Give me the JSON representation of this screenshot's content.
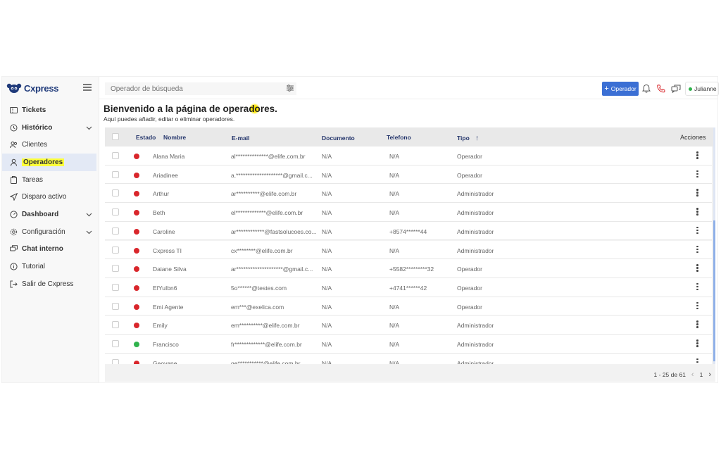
{
  "brand": {
    "name": "Cxpress"
  },
  "sidebar": {
    "items": [
      {
        "label": "Tickets",
        "icon": "ticket-icon",
        "chevron": false,
        "bold": true
      },
      {
        "label": "Histórico",
        "icon": "history-icon",
        "chevron": true,
        "bold": true
      },
      {
        "label": "Clientes",
        "icon": "users-icon",
        "chevron": false,
        "bold": false
      },
      {
        "label": "Operadores",
        "icon": "user-icon",
        "chevron": false,
        "bold": true,
        "active": true
      },
      {
        "label": "Tareas",
        "icon": "clipboard-icon",
        "chevron": false,
        "bold": false
      },
      {
        "label": "Disparo activo",
        "icon": "send-icon",
        "chevron": false,
        "bold": false
      },
      {
        "label": "Dashboard",
        "icon": "dashboard-icon",
        "chevron": true,
        "bold": true
      },
      {
        "label": "Configuración",
        "icon": "gear-icon",
        "chevron": true,
        "bold": false
      },
      {
        "label": "Chat interno",
        "icon": "chat-icon",
        "chevron": false,
        "bold": true
      },
      {
        "label": "Tutorial",
        "icon": "info-icon",
        "chevron": false,
        "bold": false
      },
      {
        "label": "Salir de Cxpress",
        "icon": "logout-icon",
        "chevron": false,
        "bold": false
      }
    ]
  },
  "topbar": {
    "search_placeholder": "Operador de búsqueda",
    "add_operator_label": "Operador",
    "user_name": "Julianne",
    "user_status_color": "#2fb24c"
  },
  "header": {
    "title_before": "Bienvenido a la página de opera",
    "title_highlight": "do",
    "title_after": "res.",
    "subtitle": "Aquí puedes añadir, editar o eliminar operadores."
  },
  "table": {
    "columns": {
      "estado": "Estado",
      "nombre": "Nombre",
      "email": "E-mail",
      "documento": "Documento",
      "telefono": "Telefono",
      "tipo": "Tipo",
      "acciones": "Acciones"
    },
    "sort_arrow": "↑",
    "rows": [
      {
        "status": "red",
        "name": "Alana Maria",
        "email": "al**************@elife.com.br",
        "doc": "N/A",
        "phone": "N/A",
        "type": "Operador"
      },
      {
        "status": "red",
        "name": "Ariadinee",
        "email": "a.********************@gmail.c...",
        "doc": "N/A",
        "phone": "N/A",
        "type": "Operador"
      },
      {
        "status": "red",
        "name": "Arthur",
        "email": "ar**********@elife.com.br",
        "doc": "N/A",
        "phone": "N/A",
        "type": "Administrador"
      },
      {
        "status": "red",
        "name": "Beth",
        "email": "el*************@elife.com.br",
        "doc": "N/A",
        "phone": "N/A",
        "type": "Administrador"
      },
      {
        "status": "red",
        "name": "Caroline",
        "email": "ar************@fastsolucoes.co...",
        "doc": "N/A",
        "phone": "+8574******44",
        "type": "Administrador"
      },
      {
        "status": "red",
        "name": "Cxpress TI",
        "email": "cx********@elife.com.br",
        "doc": "N/A",
        "phone": "N/A",
        "type": "Administrador"
      },
      {
        "status": "red",
        "name": "Daiane Silva",
        "email": "ar********************@gmail.c...",
        "doc": "N/A",
        "phone": "+5582*********32",
        "type": "Operador"
      },
      {
        "status": "red",
        "name": "EfYuIbn6",
        "email": "5o******@testes.com",
        "doc": "N/A",
        "phone": "+4741******42",
        "type": "Operador"
      },
      {
        "status": "red",
        "name": "Emi Agente",
        "email": "em***@exelica.com",
        "doc": "N/A",
        "phone": "N/A",
        "type": "Operador"
      },
      {
        "status": "red",
        "name": "Emily",
        "email": "em**********@elife.com.br",
        "doc": "N/A",
        "phone": "N/A",
        "type": "Administrador"
      },
      {
        "status": "green",
        "name": "Francisco",
        "email": "fr*************@elife.com.br",
        "doc": "N/A",
        "phone": "N/A",
        "type": "Administrador"
      },
      {
        "status": "red",
        "name": "Geovane",
        "email": "ge***********@elife.com.br",
        "doc": "N/A",
        "phone": "N/A",
        "type": "Administrador"
      }
    ],
    "status_colors": {
      "red": "#d9262b",
      "green": "#2fb24c"
    }
  },
  "pagination": {
    "range": "1 - 25 de 61",
    "page": "1"
  }
}
